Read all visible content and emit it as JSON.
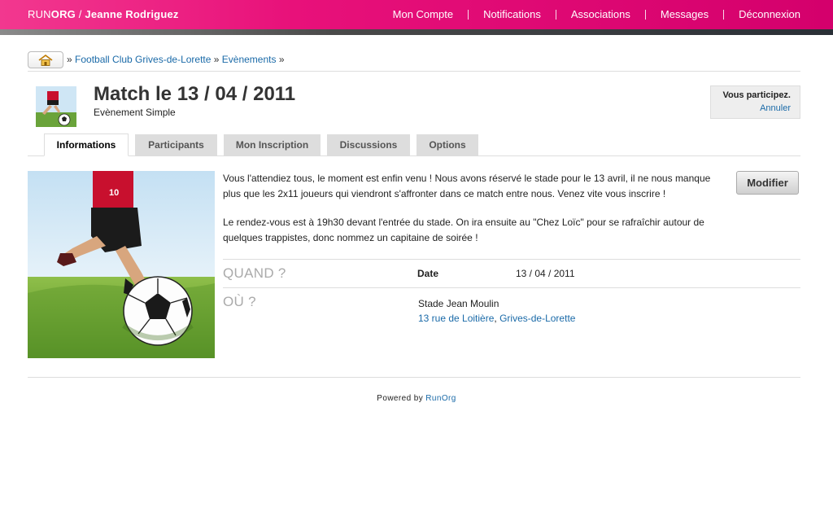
{
  "header": {
    "brand_prefix": "RUN",
    "brand_bold": "ORG",
    "separator": " / ",
    "user_name": "Jeanne Rodriguez",
    "nav": [
      "Mon Compte",
      "Notifications",
      "Associations",
      "Messages",
      "Déconnexion"
    ]
  },
  "breadcrumb": {
    "sep1": " » ",
    "club": "Football Club Grives-de-Lorette",
    "sep2": " » ",
    "events": "Evènements",
    "sep3": " »"
  },
  "event": {
    "title": "Match le 13 / 04 / 2011",
    "subtitle": "Evènement Simple"
  },
  "participation": {
    "status": "Vous participez.",
    "cancel": "Annuler"
  },
  "tabs": [
    "Informations",
    "Participants",
    "Mon Inscription",
    "Discussions",
    "Options"
  ],
  "description": {
    "p1": "Vous l'attendiez tous, le moment est enfin venu ! Nous avons réservé le stade pour le 13 avril, il ne nous manque plus que les 2x11 joueurs qui viendront s'affronter dans ce match entre nous. Venez vite vous inscrire !",
    "p2": "Le rendez-vous est à 19h30 devant l'entrée du stade. On ira ensuite au \"Chez Loïc\" pour se rafraîchir autour de quelques trappistes, donc nommez un capitaine de soirée !"
  },
  "modify_button": "Modifier",
  "when": {
    "heading": "QUAND ?",
    "key": "Date",
    "value": "13 / 04 / 2011"
  },
  "where": {
    "heading": "OÙ ?",
    "venue": "Stade Jean Moulin",
    "street": "13 rue de Loitière",
    "comma": ", ",
    "city": "Grives-de-Lorette"
  },
  "footer": {
    "text": "Powered by ",
    "link": "RunOrg"
  },
  "colors": {
    "brand_pink": "#e8117a",
    "link_blue": "#1a6aa8"
  }
}
